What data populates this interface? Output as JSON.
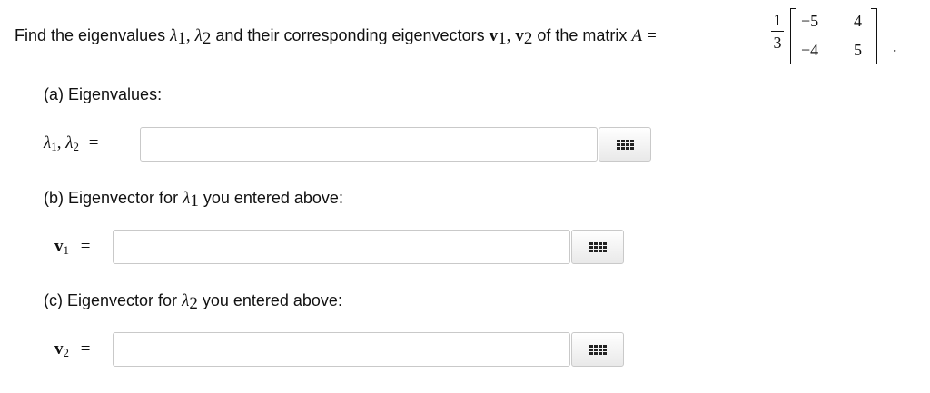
{
  "question": {
    "text_before": "Find the eigenvalues",
    "lambda": "λ",
    "sub1": "1",
    "sub2": "2",
    "comma": ",",
    "text_middle": "and their corresponding eigenvectors",
    "vector": "v",
    "text_after": "of the matrix",
    "matrix_name": "A",
    "equals": "=",
    "scalar_numerator": "1",
    "scalar_denominator": "3",
    "matrix": [
      [
        "−5",
        "4"
      ],
      [
        "−4",
        "5"
      ]
    ],
    "period": "."
  },
  "parts": {
    "a": {
      "heading": "(a) Eigenvalues:",
      "label_lambda": "λ",
      "sub1": "1",
      "sub2": "2",
      "comma": ",",
      "equals": "=",
      "input_value": ""
    },
    "b": {
      "heading_prefix": "(b) Eigenvector for",
      "lambda": "λ",
      "sub": "1",
      "heading_suffix": "you entered above:",
      "label_vector": "v",
      "label_sub": "1",
      "equals": "=",
      "input_value": ""
    },
    "c": {
      "heading_prefix": "(c) Eigenvector for",
      "lambda": "λ",
      "sub": "2",
      "heading_suffix": "you entered above:",
      "label_vector": "v",
      "label_sub": "2",
      "equals": "=",
      "input_value": ""
    }
  },
  "icons": {
    "keyboard": "keyboard-grid-icon"
  }
}
